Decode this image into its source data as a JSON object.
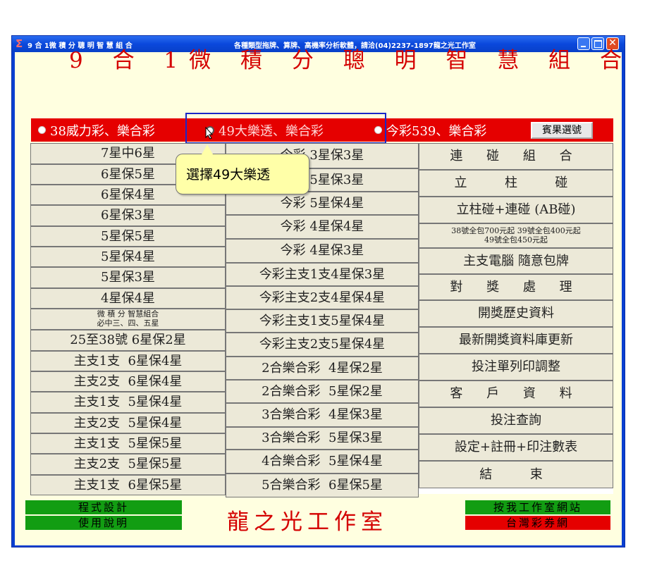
{
  "window": {
    "title_left": "9 合 1微 積 分 聰 明 智 慧 組 合",
    "title_center": "各種類型拖牌、算牌、高機率分析軟體，請洽(04)2237-1897龍之光工作室",
    "sigma": "Σ",
    "close_glyph": "✕"
  },
  "app_title": "9 合 1微 積 分 聰 明 智 慧 組 合",
  "radios": [
    {
      "label": "38威力彩、樂合彩",
      "selected": false
    },
    {
      "label": "49大樂透、樂合彩",
      "selected": true
    },
    {
      "label": "今彩539、樂合彩",
      "selected": false
    }
  ],
  "fruit_button": "賓果選號",
  "callout": "選擇49大樂透",
  "left_column": [
    "7星中6星",
    "6星保5星",
    "6星保4星",
    "6星保3星",
    "5星保5星",
    "5星保4星",
    "5星保3星",
    "4星保4星",
    "微 積 分 智慧組合|必中三、四、五星",
    "25至38號 6星保2星",
    "主支1支  6星保4星",
    "主支2支  6星保4星",
    "主支1支  5星保4星",
    "主支2支  5星保4星",
    "主支1支  5星保5星",
    "主支2支  5星保5星",
    "主支1支  6星保5星"
  ],
  "middle_column": [
    "今彩 3星保3星",
    "今彩 5星保3星",
    "今彩 5星保4星",
    "今彩 4星保4星",
    "今彩 4星保3星",
    "今彩主支1支4星保3星",
    "今彩主支2支4星保4星",
    "今彩主支1支5星保4星",
    "今彩主支2支5星保4星",
    "2合樂合彩  4星保2星",
    "2合樂合彩  5星保2星",
    "3合樂合彩  4星保3星",
    "3合樂合彩  5星保3星",
    "4合樂合彩  5星保4星",
    "5合樂合彩  6星保5星"
  ],
  "right_column": [
    "連 碰 組 合",
    "立  柱  碰",
    "立柱碰+連碰 (AB碰)",
    "38號全包700元起 39號全包400元起|49號全包450元起",
    "主支電腦 隨意包牌",
    "對 獎 處 理",
    "開獎歷史資料",
    "最新開獎資料庫更新",
    "投注單列印調整",
    "客 戶 資 料",
    "投注查詢",
    "設定+註冊+印注數表",
    "結  束"
  ],
  "bottom": {
    "program_design": "程式設計",
    "manual": "使用說明",
    "studio": "龍之光工作室",
    "website": "按我工作室網站",
    "lottery_site": "台灣彩券網"
  },
  "colors": {
    "title_red": "#d40000",
    "radio_bar": "#e50000",
    "green_button": "#129d12",
    "background": "#ffffe0"
  }
}
